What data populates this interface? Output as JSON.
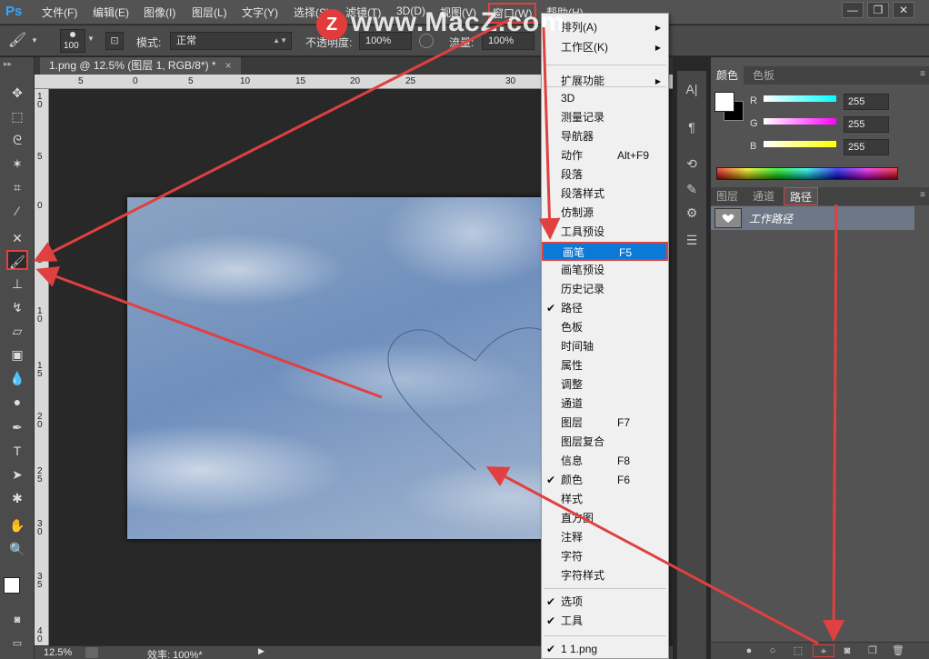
{
  "app": {
    "logo": "Ps"
  },
  "menubar": {
    "items": [
      "文件(F)",
      "编辑(E)",
      "图像(I)",
      "图层(L)",
      "文字(Y)",
      "选择(S)",
      "滤镜(T)",
      "3D(D)",
      "视图(V)",
      "窗口(W)",
      "帮助(H)"
    ],
    "window_controls": [
      "—",
      "❐",
      "✕"
    ]
  },
  "optbar": {
    "brush_size": "100",
    "mode_label": "模式:",
    "mode_value": "正常",
    "opacity_label": "不透明度:",
    "opacity_value": "100%",
    "flow_label": "流量:",
    "flow_value": "100%"
  },
  "document": {
    "tab_title": "1.png @ 12.5% (图层 1, RGB/8*) *",
    "tab_close": "×",
    "ruler_h_ticks": [
      "5",
      "0",
      "5",
      "10",
      "15",
      "20",
      "25",
      "30"
    ],
    "ruler_v_ticks": [
      "1 0",
      "5",
      "0",
      "5",
      "1 0",
      "1 5",
      "2 0",
      "2 5",
      "3 0",
      "3 5",
      "4 0"
    ]
  },
  "statusbar": {
    "zoom": "12.5%",
    "efficiency": "效率: 100%*"
  },
  "window_menu": {
    "items": [
      {
        "label": "排列(A)",
        "submenu": true
      },
      {
        "label": "工作区(K)",
        "submenu": true
      },
      {
        "sep": true
      },
      {
        "label": "扩展功能",
        "submenu": true
      },
      {
        "sep": true
      },
      {
        "label": "3D"
      },
      {
        "label": "测量记录"
      },
      {
        "label": "导航器"
      },
      {
        "label": "动作",
        "shortcut": "Alt+F9"
      },
      {
        "label": "段落"
      },
      {
        "label": "段落样式"
      },
      {
        "label": "仿制源"
      },
      {
        "label": "工具预设"
      },
      {
        "label": "画笔",
        "shortcut": "F5",
        "highlight": true
      },
      {
        "label": "画笔预设"
      },
      {
        "label": "历史记录"
      },
      {
        "label": "路径",
        "checked": true
      },
      {
        "label": "色板"
      },
      {
        "label": "时间轴"
      },
      {
        "label": "属性"
      },
      {
        "label": "调整"
      },
      {
        "label": "通道"
      },
      {
        "label": "图层",
        "shortcut": "F7"
      },
      {
        "label": "图层复合"
      },
      {
        "label": "信息",
        "shortcut": "F8"
      },
      {
        "label": "颜色",
        "shortcut": "F6",
        "checked": true
      },
      {
        "label": "样式"
      },
      {
        "label": "直方图"
      },
      {
        "label": "注释"
      },
      {
        "label": "字符"
      },
      {
        "label": "字符样式"
      },
      {
        "sep": true
      },
      {
        "label": "选项",
        "checked": true
      },
      {
        "label": "工具",
        "checked": true
      },
      {
        "sep": true
      },
      {
        "label": "1 1.png",
        "checked": true
      }
    ]
  },
  "color_panel": {
    "tabs": [
      "颜色",
      "色板"
    ],
    "channels": [
      {
        "name": "R",
        "value": "255",
        "gradient": "#00ffff"
      },
      {
        "name": "G",
        "value": "255",
        "gradient": "#ff00ff"
      },
      {
        "name": "B",
        "value": "255",
        "gradient": "#ffff00"
      }
    ]
  },
  "layers_panel": {
    "tabs": [
      "图层",
      "通道",
      "路径"
    ],
    "path_name": "工作路径"
  },
  "watermark": {
    "text": "www.MacZ.com",
    "badge": "Z"
  },
  "colors": {
    "highlight": "#0a79d8",
    "annotation": "#e04040"
  }
}
